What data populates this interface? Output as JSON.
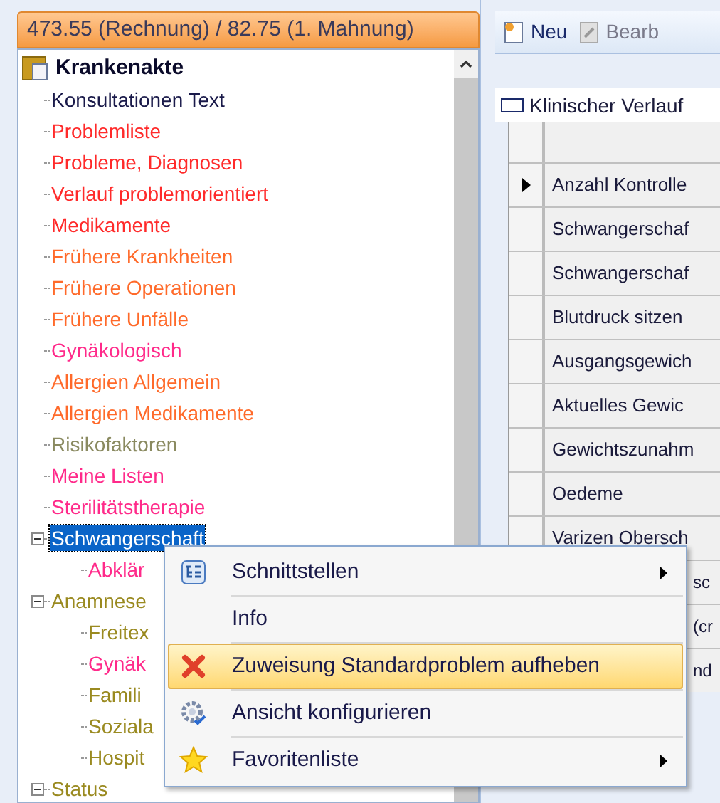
{
  "balance_bar": {
    "text": "473.55 (Rechnung) / 82.75 (1. Mahnung)"
  },
  "tree": {
    "label": "Krankenakte",
    "children": [
      {
        "label": "Konsultationen Text",
        "color": "#1a1a4a",
        "selected": false
      },
      {
        "label": "Problemliste",
        "color": "#ff2a2a",
        "selected": false
      },
      {
        "label": "Probleme, Diagnosen",
        "color": "#ff2a2a",
        "selected": false
      },
      {
        "label": "Verlauf problemorientiert",
        "color": "#ff2a2a",
        "selected": false
      },
      {
        "label": "Medikamente",
        "color": "#ff2a2a",
        "selected": false
      },
      {
        "label": "Frühere Krankheiten",
        "color": "#ff6a2a",
        "selected": false
      },
      {
        "label": "Frühere Operationen",
        "color": "#ff6a2a",
        "selected": false
      },
      {
        "label": "Frühere Unfälle",
        "color": "#ff6a2a",
        "selected": false
      },
      {
        "label": "Gynäkologisch",
        "color": "#ff2a8a",
        "selected": false
      },
      {
        "label": "Allergien Allgemein",
        "color": "#ff6a2a",
        "selected": false
      },
      {
        "label": "Allergien Medikamente",
        "color": "#ff6a2a",
        "selected": false
      },
      {
        "label": "Risikofaktoren",
        "color": "#8a8a60",
        "selected": false
      },
      {
        "label": "Meine Listen",
        "color": "#ff2a8a",
        "selected": false
      },
      {
        "label": "Sterilitätstherapie",
        "color": "#ff2a8a",
        "selected": false
      },
      {
        "label": "Schwangerschaft",
        "selected": true,
        "expanded": true,
        "children": [
          {
            "label": "Abklär",
            "color": "#ff2a8a",
            "selected": false
          }
        ]
      },
      {
        "label": "Anamnese",
        "color": "#9a8a20",
        "selected": false,
        "expanded": true,
        "children": [
          {
            "label": "Freitex",
            "color": "#9a8a20",
            "selected": false
          },
          {
            "label": "Gynäk",
            "color": "#ff2a8a",
            "selected": false
          },
          {
            "label": "Famili",
            "color": "#9a8a20",
            "selected": false
          },
          {
            "label": "Soziala",
            "color": "#9a8a20",
            "selected": false
          },
          {
            "label": "Hospit",
            "color": "#9a8a20",
            "selected": false
          }
        ]
      },
      {
        "label": "Status",
        "color": "#9a8a20",
        "selected": false,
        "expanded": true
      }
    ]
  },
  "toolbar": [
    {
      "label": "Neu",
      "disabled": false
    },
    {
      "label": "Bearb",
      "disabled": true
    }
  ],
  "tab": {
    "label": "Klinischer Verlauf"
  },
  "grid_rows": [
    {
      "text": "Anzahl Kontrolle",
      "current": true,
      "covered": false
    },
    {
      "text": "Schwangerschaf",
      "current": false,
      "covered": false
    },
    {
      "text": "Schwangerschaf",
      "current": false,
      "covered": false
    },
    {
      "text": "Blutdruck sitzen",
      "current": false,
      "covered": false
    },
    {
      "text": "Ausgangsgewich",
      "current": false,
      "covered": false
    },
    {
      "text": "Aktuelles Gewic",
      "current": false,
      "covered": false
    },
    {
      "text": "Gewichtszunahm",
      "current": false,
      "covered": false
    },
    {
      "text": "Oedeme",
      "current": false,
      "covered": false
    },
    {
      "text": "Varizen Obersch",
      "current": false,
      "covered": false
    },
    {
      "text": "sc",
      "current": false,
      "covered": true
    },
    {
      "text": "(cr",
      "current": false,
      "covered": true
    },
    {
      "text": "nd",
      "current": false,
      "covered": true
    }
  ],
  "context_menu": [
    {
      "kind": "interfaces",
      "label": "Schnittstellen",
      "submenu": true,
      "selected": false
    },
    {
      "kind": "plain",
      "label": "Info",
      "submenu": false,
      "selected": false
    },
    {
      "kind": "remove",
      "label": "Zuweisung Standardproblem aufheben",
      "submenu": false,
      "selected": true
    },
    {
      "kind": "configure",
      "label": "Ansicht konfigurieren",
      "submenu": false,
      "selected": false
    },
    {
      "kind": "favorite",
      "label": "Favoritenliste",
      "submenu": true,
      "selected": false
    }
  ]
}
